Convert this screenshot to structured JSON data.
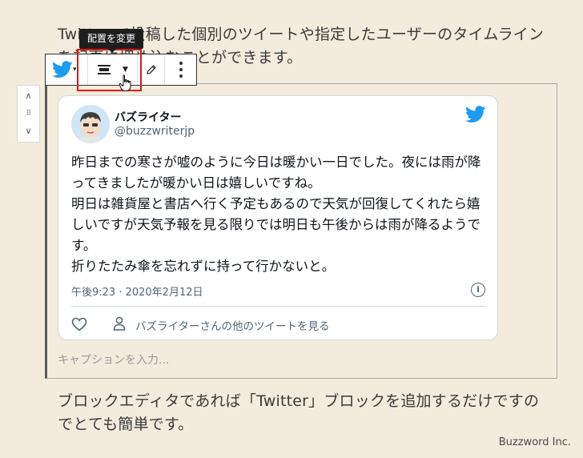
{
  "paragraphs": {
    "top": "Twitter で投稿した個別のツイートや指定したユーザーのタイムラインを記事に埋め込むことができます。",
    "bottom": "ブロックエディタであれば「Twitter」ブロックを追加するだけですのでとても簡単です。"
  },
  "toolbar": {
    "tooltip": "配置を変更",
    "block_icon": "twitter-icon",
    "align_icon": "align-center-icon",
    "edit_icon": "pencil-icon",
    "more_icon": "more-vertical-icon"
  },
  "mover": {
    "up": "∧",
    "drag": "⠿",
    "down": "∨"
  },
  "tweet": {
    "author_name": "バズライター",
    "author_handle": "@buzzwriterjp",
    "lines": [
      "昨日までの寒さが嘘のように今日は暖かい一日でした。夜には雨が降",
      "ってきましたが暖かい日は嬉しいですね。",
      "明日は雑貨屋と書店へ行く予定もあるので天気が回復してくれたら嬉",
      "しいですが天気予報を見る限りでは明日も午後からは雨が降るようで",
      "す。",
      "折りたたみ傘を忘れずに持って行かないと。"
    ],
    "timestamp": "午後9:23 · 2020年2月12日",
    "info": "i",
    "more_link": "バズライターさんの他のツイートを見る"
  },
  "caption_placeholder": "キャプションを入力...",
  "credit": "Buzzword Inc.",
  "colors": {
    "background": "#f3ecdc",
    "twitter_blue": "#1d9bf0",
    "highlight": "#e01a1a"
  }
}
